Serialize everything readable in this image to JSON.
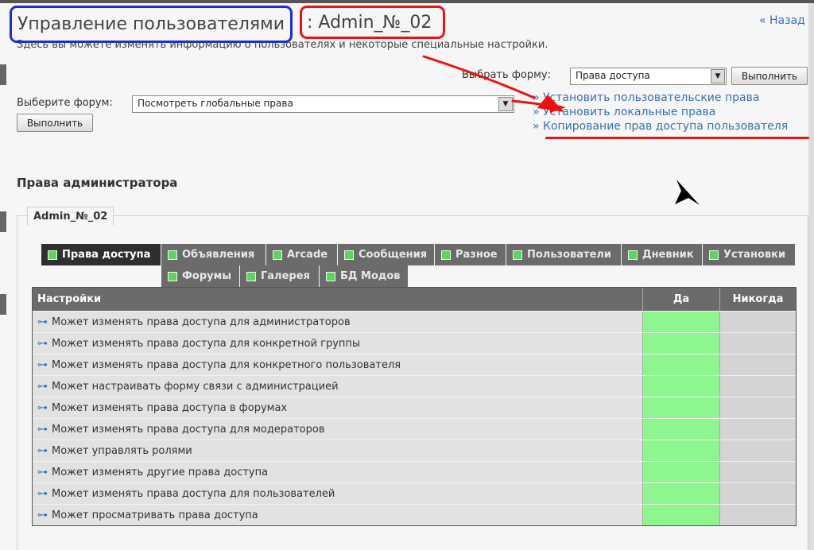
{
  "header": {
    "title": "Управление пользователями",
    "user": ": Admin_№_02",
    "back_link": "« Назад",
    "description": "Здесь вы можете изменять информацию о пользователях и некоторые специальные настройки."
  },
  "form_select": {
    "label": "Выбрать форму:",
    "value": "Права доступа",
    "submit": "Выполнить"
  },
  "forum_select": {
    "label": "Выберите форум:",
    "value": "Посмотреть глобальные права",
    "submit": "Выполнить"
  },
  "action_links": [
    "» Установить пользовательские права",
    "» Установить локальные права",
    "» Копирование прав доступа пользователя"
  ],
  "section": {
    "title": "Права администратора",
    "legend": "Admin_№_02"
  },
  "tabs": [
    "Права доступа",
    "Объявления",
    "Arcade",
    "Сообщения",
    "Разное",
    "Пользователи",
    "Дневник",
    "Установки",
    "Форумы",
    "Галерея",
    "БД Модов"
  ],
  "tabs_active_index": 0,
  "table": {
    "headers": [
      "Настройки",
      "Да",
      "Никогда"
    ],
    "rows": [
      "Может изменять права доступа для администраторов",
      "Может изменять права доступа для конкретной группы",
      "Может изменять права доступа для конкретного пользователя",
      "Может настраивать форму связи с администрацией",
      "Может изменять права доступа в форумах",
      "Может изменять права доступа для модераторов",
      "Может управлять ролями",
      "Может изменять другие права доступа",
      "Может изменять права доступа для пользователей",
      "Может просматривать права доступа"
    ]
  },
  "colors": {
    "yes_cell": "#8ef68e",
    "never_cell": "#d4d4d4",
    "link": "#3a6fb5",
    "highlight_red": "#e11111",
    "highlight_blue": "#1a2be0"
  }
}
